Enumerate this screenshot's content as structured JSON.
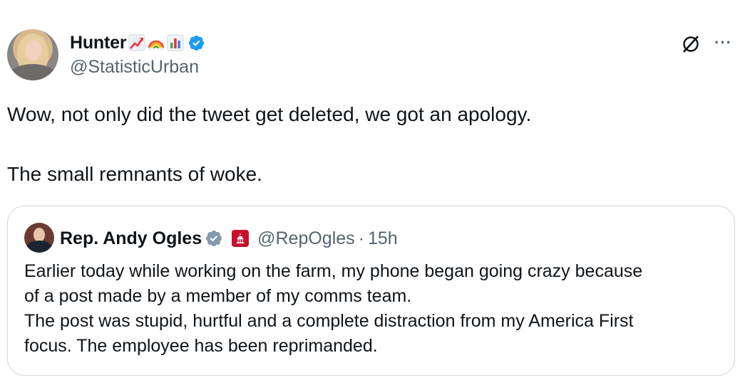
{
  "tweet": {
    "author": {
      "display_name": "Hunter",
      "name_emojis": [
        "chart-increasing-emoji",
        "rainbow-emoji",
        "bar-chart-emoji"
      ],
      "handle": "@StatisticUrban",
      "verified": true,
      "verified_color": "#1d9bf0"
    },
    "text_lines": [
      "Wow, not only did the tweet get deleted, we got an apology.",
      "The small remnants of woke."
    ],
    "actions": {
      "grok_icon": "grok-icon",
      "more_label": "···"
    }
  },
  "quote": {
    "author": {
      "display_name": "Rep. Andy Ogles",
      "verified": true,
      "verified_color": "#829aab",
      "affiliation_badge_color": "#c8102e",
      "handle": "@RepOgles",
      "separator": "·",
      "time": "15h"
    },
    "text_lines": [
      "Earlier today while working on the farm, my phone began going crazy because",
      "of a post made by a member of my comms team.",
      "The post was stupid, hurtful and a complete distraction from my America First",
      "focus. The employee has been reprimanded."
    ]
  }
}
